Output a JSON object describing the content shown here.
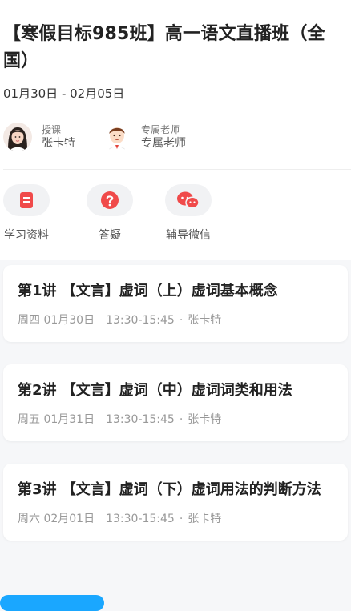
{
  "course": {
    "title": "【寒假目标985班】高一语文直播班（全国）",
    "date_range": "01月30日 - 02月05日"
  },
  "teachers": [
    {
      "role": "授课",
      "name": "张卡特",
      "avatar_icon": "female-teacher-avatar"
    },
    {
      "role": "专属老师",
      "name": "专属老师",
      "avatar_icon": "male-teacher-avatar"
    }
  ],
  "tools": [
    {
      "label": "学习资料",
      "icon": "document-icon",
      "color": "#f04a4a"
    },
    {
      "label": "答疑",
      "icon": "question-icon",
      "color": "#f04a4a"
    },
    {
      "label": "辅导微信",
      "icon": "wechat-icon",
      "color": "#f04a4a"
    }
  ],
  "lessons": [
    {
      "title": "第1讲 【文言】虚词（上）虚词基本概念",
      "day": "周四 01月30日",
      "time": "13:30-15:45",
      "separator": "·",
      "teacher": "张卡特"
    },
    {
      "title": "第2讲 【文言】虚词（中）虚词词类和用法",
      "day": "周五 01月31日",
      "time": "13:30-15:45",
      "separator": "·",
      "teacher": "张卡特"
    },
    {
      "title": "第3讲 【文言】虚词（下）虚词用法的判断方法",
      "day": "周六 02月01日",
      "time": "13:30-15:45",
      "separator": "·",
      "teacher": "张卡特"
    }
  ],
  "colors": {
    "accent_red": "#f04a4a",
    "accent_blue": "#1aa7ff"
  }
}
